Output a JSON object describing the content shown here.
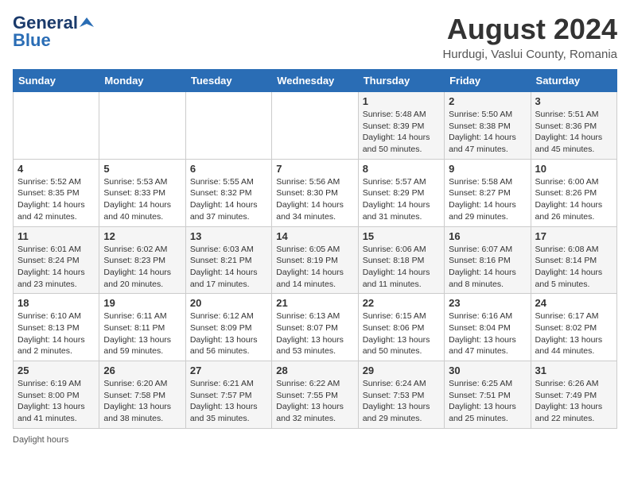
{
  "header": {
    "logo_general": "General",
    "logo_blue": "Blue",
    "month_year": "August 2024",
    "location": "Hurdugi, Vaslui County, Romania"
  },
  "weekdays": [
    "Sunday",
    "Monday",
    "Tuesday",
    "Wednesday",
    "Thursday",
    "Friday",
    "Saturday"
  ],
  "weeks": [
    [
      {
        "day": "",
        "info": ""
      },
      {
        "day": "",
        "info": ""
      },
      {
        "day": "",
        "info": ""
      },
      {
        "day": "",
        "info": ""
      },
      {
        "day": "1",
        "info": "Sunrise: 5:48 AM\nSunset: 8:39 PM\nDaylight: 14 hours\nand 50 minutes."
      },
      {
        "day": "2",
        "info": "Sunrise: 5:50 AM\nSunset: 8:38 PM\nDaylight: 14 hours\nand 47 minutes."
      },
      {
        "day": "3",
        "info": "Sunrise: 5:51 AM\nSunset: 8:36 PM\nDaylight: 14 hours\nand 45 minutes."
      }
    ],
    [
      {
        "day": "4",
        "info": "Sunrise: 5:52 AM\nSunset: 8:35 PM\nDaylight: 14 hours\nand 42 minutes."
      },
      {
        "day": "5",
        "info": "Sunrise: 5:53 AM\nSunset: 8:33 PM\nDaylight: 14 hours\nand 40 minutes."
      },
      {
        "day": "6",
        "info": "Sunrise: 5:55 AM\nSunset: 8:32 PM\nDaylight: 14 hours\nand 37 minutes."
      },
      {
        "day": "7",
        "info": "Sunrise: 5:56 AM\nSunset: 8:30 PM\nDaylight: 14 hours\nand 34 minutes."
      },
      {
        "day": "8",
        "info": "Sunrise: 5:57 AM\nSunset: 8:29 PM\nDaylight: 14 hours\nand 31 minutes."
      },
      {
        "day": "9",
        "info": "Sunrise: 5:58 AM\nSunset: 8:27 PM\nDaylight: 14 hours\nand 29 minutes."
      },
      {
        "day": "10",
        "info": "Sunrise: 6:00 AM\nSunset: 8:26 PM\nDaylight: 14 hours\nand 26 minutes."
      }
    ],
    [
      {
        "day": "11",
        "info": "Sunrise: 6:01 AM\nSunset: 8:24 PM\nDaylight: 14 hours\nand 23 minutes."
      },
      {
        "day": "12",
        "info": "Sunrise: 6:02 AM\nSunset: 8:23 PM\nDaylight: 14 hours\nand 20 minutes."
      },
      {
        "day": "13",
        "info": "Sunrise: 6:03 AM\nSunset: 8:21 PM\nDaylight: 14 hours\nand 17 minutes."
      },
      {
        "day": "14",
        "info": "Sunrise: 6:05 AM\nSunset: 8:19 PM\nDaylight: 14 hours\nand 14 minutes."
      },
      {
        "day": "15",
        "info": "Sunrise: 6:06 AM\nSunset: 8:18 PM\nDaylight: 14 hours\nand 11 minutes."
      },
      {
        "day": "16",
        "info": "Sunrise: 6:07 AM\nSunset: 8:16 PM\nDaylight: 14 hours\nand 8 minutes."
      },
      {
        "day": "17",
        "info": "Sunrise: 6:08 AM\nSunset: 8:14 PM\nDaylight: 14 hours\nand 5 minutes."
      }
    ],
    [
      {
        "day": "18",
        "info": "Sunrise: 6:10 AM\nSunset: 8:13 PM\nDaylight: 14 hours\nand 2 minutes."
      },
      {
        "day": "19",
        "info": "Sunrise: 6:11 AM\nSunset: 8:11 PM\nDaylight: 13 hours\nand 59 minutes."
      },
      {
        "day": "20",
        "info": "Sunrise: 6:12 AM\nSunset: 8:09 PM\nDaylight: 13 hours\nand 56 minutes."
      },
      {
        "day": "21",
        "info": "Sunrise: 6:13 AM\nSunset: 8:07 PM\nDaylight: 13 hours\nand 53 minutes."
      },
      {
        "day": "22",
        "info": "Sunrise: 6:15 AM\nSunset: 8:06 PM\nDaylight: 13 hours\nand 50 minutes."
      },
      {
        "day": "23",
        "info": "Sunrise: 6:16 AM\nSunset: 8:04 PM\nDaylight: 13 hours\nand 47 minutes."
      },
      {
        "day": "24",
        "info": "Sunrise: 6:17 AM\nSunset: 8:02 PM\nDaylight: 13 hours\nand 44 minutes."
      }
    ],
    [
      {
        "day": "25",
        "info": "Sunrise: 6:19 AM\nSunset: 8:00 PM\nDaylight: 13 hours\nand 41 minutes."
      },
      {
        "day": "26",
        "info": "Sunrise: 6:20 AM\nSunset: 7:58 PM\nDaylight: 13 hours\nand 38 minutes."
      },
      {
        "day": "27",
        "info": "Sunrise: 6:21 AM\nSunset: 7:57 PM\nDaylight: 13 hours\nand 35 minutes."
      },
      {
        "day": "28",
        "info": "Sunrise: 6:22 AM\nSunset: 7:55 PM\nDaylight: 13 hours\nand 32 minutes."
      },
      {
        "day": "29",
        "info": "Sunrise: 6:24 AM\nSunset: 7:53 PM\nDaylight: 13 hours\nand 29 minutes."
      },
      {
        "day": "30",
        "info": "Sunrise: 6:25 AM\nSunset: 7:51 PM\nDaylight: 13 hours\nand 25 minutes."
      },
      {
        "day": "31",
        "info": "Sunrise: 6:26 AM\nSunset: 7:49 PM\nDaylight: 13 hours\nand 22 minutes."
      }
    ]
  ],
  "footer": {
    "daylight_label": "Daylight hours"
  }
}
